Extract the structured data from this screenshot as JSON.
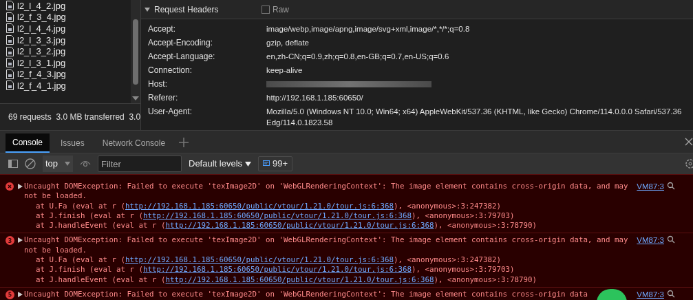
{
  "network": {
    "files": [
      {
        "name": "l2_l_4_2.jpg"
      },
      {
        "name": "l2_f_3_4.jpg"
      },
      {
        "name": "l2_l_4_4.jpg"
      },
      {
        "name": "l2_l_3_3.jpg"
      },
      {
        "name": "l2_l_3_2.jpg"
      },
      {
        "name": "l2_l_3_1.jpg"
      },
      {
        "name": "l2_f_4_3.jpg"
      },
      {
        "name": "l2_f_4_1.jpg"
      }
    ],
    "summary": "69 requests  3.0 MB transferred  3.0"
  },
  "headers": {
    "title": "Request Headers",
    "expanded": true,
    "raw": {
      "label": "Raw",
      "checked": false
    },
    "rows": [
      {
        "key": "Accept:",
        "value": "image/webp,image/apng,image/svg+xml,image/*,*/*;q=0.8"
      },
      {
        "key": "Accept-Encoding:",
        "value": "gzip, deflate"
      },
      {
        "key": "Accept-Language:",
        "value": "en,zh-CN;q=0.9,zh;q=0.8,en-GB;q=0.7,en-US;q=0.6"
      },
      {
        "key": "Connection:",
        "value": "keep-alive"
      },
      {
        "key": "Host:",
        "redacted": true
      },
      {
        "key": "Referer:",
        "value": "http://192.168.1.185:60650/"
      },
      {
        "key": "User-Agent:",
        "value": "Mozilla/5.0 (Windows NT 10.0; Win64; x64) AppleWebKit/537.36 (KHTML, like Gecko) Chrome/114.0.0.0 Safari/537.36 Edg/114.0.1823.58"
      }
    ]
  },
  "tabs": [
    {
      "label": "Console",
      "selected": true
    },
    {
      "label": "Issues",
      "selected": false
    },
    {
      "label": "Network Console",
      "selected": false
    }
  ],
  "toolbar": {
    "context": "top",
    "filter_placeholder": "Filter",
    "levels": "Default levels",
    "badge": "99+"
  },
  "messages": [
    {
      "text": "Uncaught DOMException: Failed to execute 'texImage2D' on 'WebGLRenderingContext': The image element contains cross-origin data, and may not be loaded.",
      "location": "VM87:3",
      "stack": [
        {
          "prefix": "at U.Fa (eval at r (",
          "url": "http://192.168.1.185:60650/public/vtour/1.21.0/tour.js:6:368",
          "suffix": "), <anonymous>:3:247382)"
        },
        {
          "prefix": "at J.finish (eval at r (",
          "url": "http://192.168.1.185:60650/public/vtour/1.21.0/tour.js:6:368",
          "suffix": "), <anonymous>:3:79703)"
        },
        {
          "prefix": "at J.handleEvent (eval at r (",
          "url": "http://192.168.1.185:60650/public/vtour/1.21.0/tour.js:6:368",
          "suffix": "), <anonymous>:3:78790)"
        }
      ]
    },
    {
      "count": "3",
      "text": "Uncaught DOMException: Failed to execute 'texImage2D' on 'WebGLRenderingContext': The image element contains cross-origin data, and may not be loaded.",
      "location": "VM87:3",
      "stack": [
        {
          "prefix": "at U.Fa (eval at r (",
          "url": "http://192.168.1.185:60650/public/vtour/1.21.0/tour.js:6:368",
          "suffix": "), <anonymous>:3:247382)"
        },
        {
          "prefix": "at J.finish (eval at r (",
          "url": "http://192.168.1.185:60650/public/vtour/1.21.0/tour.js:6:368",
          "suffix": "), <anonymous>:3:79703)"
        },
        {
          "prefix": "at J.handleEvent (eval at r (",
          "url": "http://192.168.1.185:60650/public/vtour/1.21.0/tour.js:6:368",
          "suffix": "), <anonymous>:3:78790)"
        }
      ]
    },
    {
      "count": "5",
      "text": "Uncaught DOMException: Failed to execute 'texImage2D' on 'WebGLRenderingContext': The image element contains cross-origin data",
      "location": "VM87:3"
    }
  ]
}
